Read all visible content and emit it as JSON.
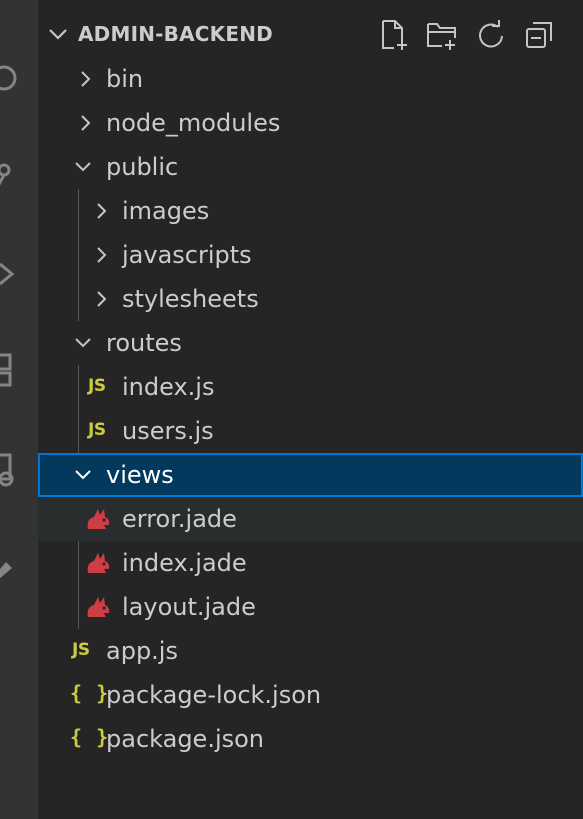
{
  "colors": {
    "background": "#252526",
    "activity_bar": "#333333",
    "selected_bg": "#04395e",
    "selected_border": "#0078d4",
    "hover_bg": "#2a2d2e",
    "js_icon": "#cbcb41",
    "jade_icon": "#cc3e44",
    "text": "#cccccc"
  },
  "explorer": {
    "title": "ADMIN-BACKEND",
    "actions": [
      "new-file-icon",
      "new-folder-icon",
      "refresh-icon",
      "collapse-all-icon"
    ]
  },
  "tree": {
    "bin": "bin",
    "node_modules": "node_modules",
    "public": "public",
    "images": "images",
    "javascripts": "javascripts",
    "stylesheets": "stylesheets",
    "routes": "routes",
    "routes_index": "index.js",
    "users": "users.js",
    "views": "views",
    "error": "error.jade",
    "views_index": "index.jade",
    "layout": "layout.jade",
    "app": "app.js",
    "package_lock": "package-lock.json",
    "package": "package.json"
  },
  "icons": {
    "js": "JS",
    "json": "{ }"
  }
}
